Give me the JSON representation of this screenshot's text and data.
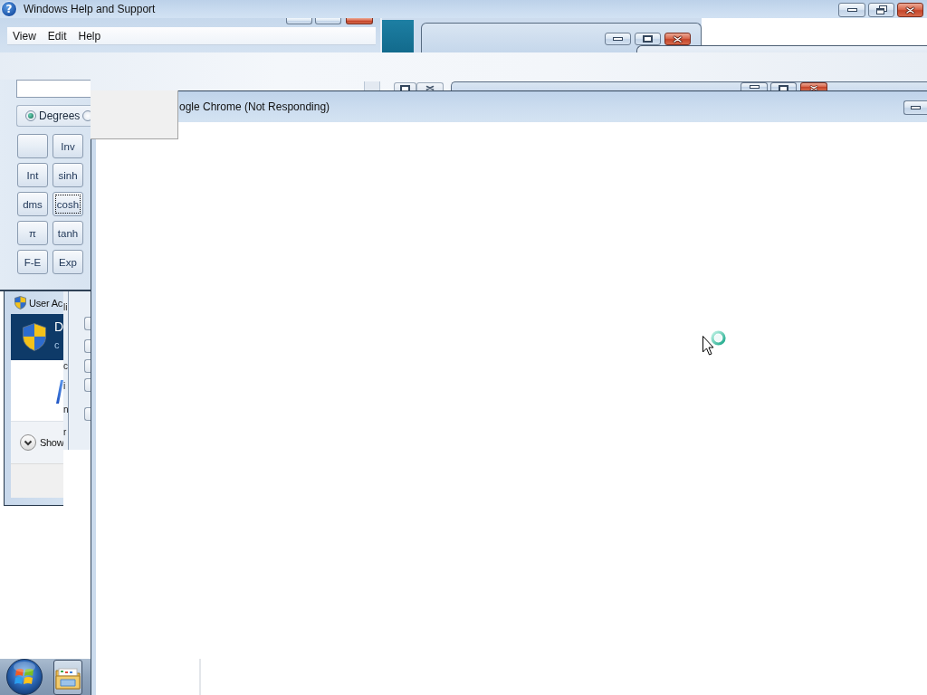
{
  "help_window": {
    "icon": "?",
    "title": "Windows Help and Support"
  },
  "calculator": {
    "menu": [
      "View",
      "Edit",
      "Help"
    ],
    "angle_units": [
      {
        "label": "Degrees",
        "selected": true
      },
      {
        "selected": false
      }
    ],
    "keys": [
      {
        "kind": "blank",
        "focused": false
      },
      {
        "kind": "text",
        "label": "Inv",
        "focused": false
      },
      {
        "kind": "text",
        "label": "Int",
        "focused": false
      },
      {
        "kind": "text",
        "label": "sinh",
        "focused": false
      },
      {
        "kind": "text",
        "label": "dms",
        "focused": false
      },
      {
        "kind": "text",
        "label": "cosh",
        "focused": true
      },
      {
        "kind": "text",
        "label": "π",
        "focused": false
      },
      {
        "kind": "text",
        "label": "tanh",
        "focused": false
      },
      {
        "kind": "text",
        "label": "F-E",
        "focused": false
      },
      {
        "kind": "text",
        "label": "Exp",
        "focused": false
      }
    ]
  },
  "chrome_window": {
    "title": "ogle Chrome (Not Responding)"
  },
  "uac_window": {
    "title": "User Ac",
    "heading": "D",
    "subheading": "c",
    "details_toggle": "Show",
    "side_fragments": [
      "li",
      "c",
      "i",
      "n",
      "r"
    ]
  }
}
